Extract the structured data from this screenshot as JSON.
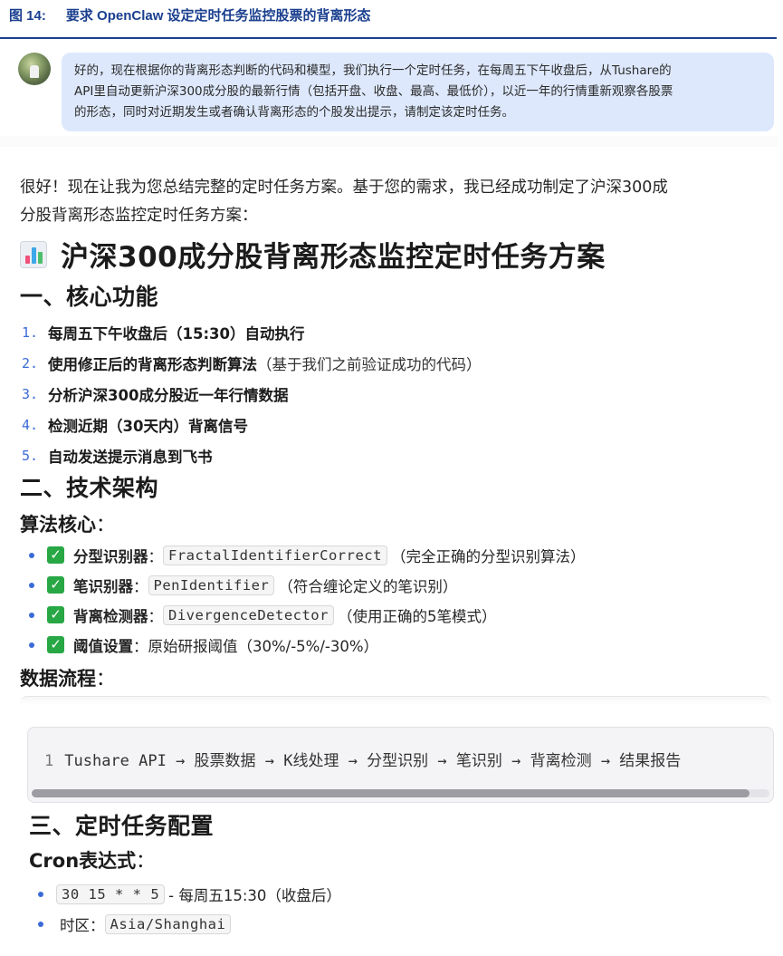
{
  "figure": {
    "number": "图 14:",
    "title": "要求 OpenClaw 设定定时任务监控股票的背离形态"
  },
  "user_message": {
    "lines": [
      "好的，现在根据你的背离形态判断的代码和模型，我们执行一个定时任务，在每周五下午收盘后，从Tushare的",
      "API里自动更新沪深300成分股的最新行情（包括开盘、收盘、最高、最低价），以近一年的行情重新观察各股票",
      "的形态，同时对近期发生或者确认背离形态的个股发出提示，请制定该定时任务。"
    ]
  },
  "answer": {
    "intro_lines": [
      "很好！现在让我为您总结完整的定时任务方案。基于您的需求，我已经成功制定了沪深300成",
      "分股背离形态监控定时任务方案："
    ],
    "title_icon": "bar-chart-emoji",
    "title": "沪深300成分股背离形态监控定时任务方案",
    "section1": {
      "heading": "一、核心功能",
      "items": [
        {
          "num": "1.",
          "bold": "每周五下午收盘后（15:30）自动执行",
          "rest": ""
        },
        {
          "num": "2.",
          "bold": "使用修正后的背离形态判断算法",
          "rest": "（基于我们之前验证成功的代码）"
        },
        {
          "num": "3.",
          "bold": "分析沪深300成分股近一年行情数据",
          "rest": ""
        },
        {
          "num": "4.",
          "bold": "检测近期（30天内）背离信号",
          "rest": ""
        },
        {
          "num": "5.",
          "bold": "自动发送提示消息到飞书",
          "rest": ""
        }
      ]
    },
    "section2": {
      "heading": "二、技术架构",
      "algo_heading": "算法核心",
      "colon": "：",
      "algo_items": [
        {
          "label": "分型识别器",
          "sep": "：",
          "code": "FractalIdentifierCorrect",
          "desc": "（完全正确的分型识别算法）"
        },
        {
          "label": "笔识别器",
          "sep": "：",
          "code": "PenIdentifier",
          "desc": "（符合缠论定义的笔识别）"
        },
        {
          "label": "背离检测器",
          "sep": "：",
          "code": "DivergenceDetector",
          "desc": "（使用正确的5笔模式）"
        },
        {
          "label": "阈值设置",
          "sep": "：",
          "code": "",
          "desc": "原始研报阈值（30%/-5%/-30%）"
        }
      ],
      "flow_heading": "数据流程",
      "flow_code": {
        "line_number": "1",
        "text": "Tushare API → 股票数据 → K线处理 → 分型识别 → 笔识别 → 背离检测 → 结果报告"
      }
    },
    "section3": {
      "heading": "三、定时任务配置",
      "cron_heading": "Cron表达式",
      "cron_items": [
        {
          "prefix": "",
          "code": "30 15 * * 5",
          "text": "- 每周五15:30（收盘后）"
        },
        {
          "prefix": "时区：",
          "code": "Asia/Shanghai",
          "text": ""
        }
      ]
    }
  },
  "colors": {
    "figure_title": "#1a3f8f",
    "bubble_bg": "#dde8fc",
    "list_number": "#3a6bd6",
    "check_green": "#28a745"
  }
}
